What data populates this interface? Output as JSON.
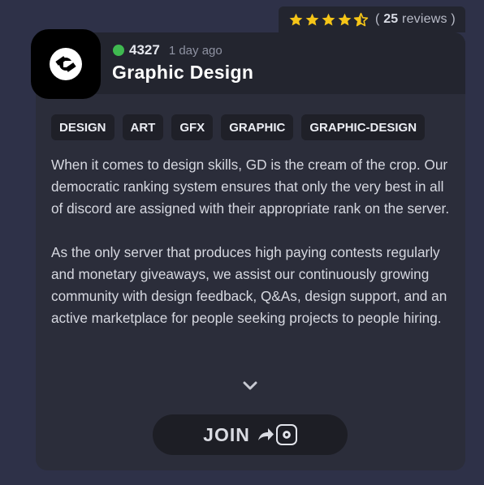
{
  "rating": {
    "stars": 4.5,
    "reviews_open": "(",
    "reviews_count": "25",
    "reviews_suffix": "reviews )"
  },
  "server": {
    "logo_icon": "gd-logo-icon",
    "online_color": "#3fb950",
    "member_count": "4327",
    "time_ago": "1 day ago",
    "name": "Graphic Design"
  },
  "tags": [
    "DESIGN",
    "ART",
    "GFX",
    "GRAPHIC",
    "GRAPHIC-DESIGN"
  ],
  "description": {
    "paragraph1": "When it comes to design skills, GD is the cream of the crop. Our democratic ranking system ensures that only the very best in all of discord are assigned with their appropriate rank on the server.",
    "paragraph2": "As the only server that produces high paying contests regularly and monetary giveaways, we assist our continuously growing community with design feedback, Q&As, design support, and an active marketplace for people seeking projects to people hiring."
  },
  "expand_icon": "chevron-down-icon",
  "join": {
    "label": "JOIN",
    "arrow_icon": "share-arrow-icon",
    "logo_icon": "gd-logo-small-icon"
  },
  "colors": {
    "page_bg": "#2e3148",
    "card_bg": "#2b2d3a",
    "header_bg": "#23252f",
    "star": "#f5c518",
    "tag_bg": "#1f2028"
  }
}
